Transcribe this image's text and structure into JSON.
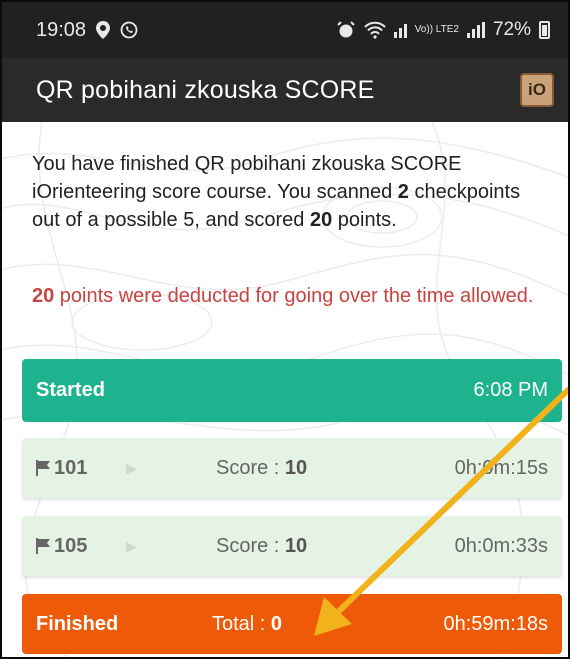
{
  "status_bar": {
    "time": "19:08",
    "network_label": "Vo)) LTE2",
    "battery": "72%",
    "icons": [
      "location-pin-icon",
      "whatsapp-icon",
      "alarm-icon",
      "wifi-icon",
      "signal-icon",
      "battery-icon"
    ]
  },
  "app_bar": {
    "title": "QR pobihani zkouska SCORE",
    "logo_text": "iO"
  },
  "summary": {
    "part1": "You have finished QR pobihani zkouska SCORE iOrienteering score course. You scanned ",
    "scanned": "2",
    "part2": " checkpoints out of a possible 5, and scored ",
    "scored": "20",
    "part3": " points."
  },
  "deduction": {
    "points": "20",
    "text": " points were deducted for going over the time allowed."
  },
  "started": {
    "label": "Started",
    "time": "6:08 PM"
  },
  "checkpoints": [
    {
      "code": "101",
      "score_label": "Score : ",
      "score": "10",
      "time": "0h:0m:15s"
    },
    {
      "code": "105",
      "score_label": "Score : ",
      "score": "10",
      "time": "0h:0m:33s"
    }
  ],
  "finished": {
    "label": "Finished",
    "total_label": "Total : ",
    "total": "0",
    "time": "0h:59m:18s"
  },
  "colors": {
    "started": "#1db38f",
    "finished": "#ef5a08",
    "checkpoint": "#e4f3e4",
    "deduction_text": "#c8433f",
    "annotation_arrow": "#f2b21b"
  }
}
